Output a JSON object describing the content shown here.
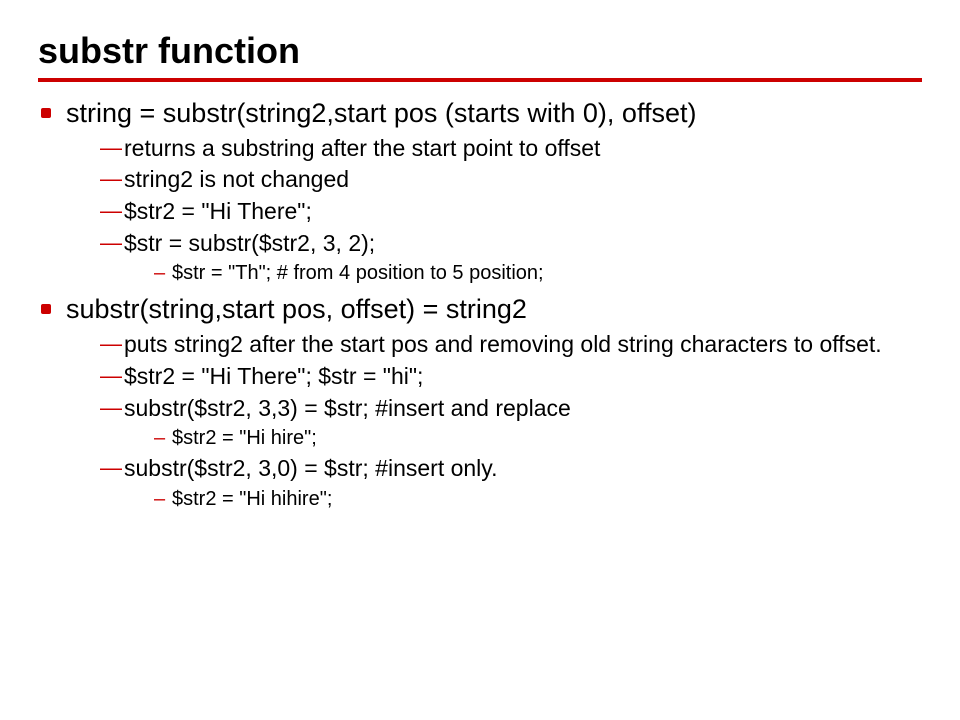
{
  "title": "substr function",
  "bullets": [
    {
      "text": "string = substr(string2,start pos (starts with 0), offset)",
      "sub": [
        {
          "text": "returns a substring after the start point to offset"
        },
        {
          "text": "string2 is not changed"
        },
        {
          "text": "$str2 = \"Hi There\";"
        },
        {
          "text": "$str = substr($str2, 3, 2);",
          "sub": [
            {
              "text": "$str = \"Th\"; # from 4 position to 5 position;"
            }
          ]
        }
      ]
    },
    {
      "text": "substr(string,start pos, offset) = string2",
      "sub": [
        {
          "text": "puts string2 after the start pos and removing old string characters to offset."
        },
        {
          "text": "$str2 = \"Hi There\"; $str = \"hi\";"
        },
        {
          "text": "substr($str2, 3,3) = $str; #insert and replace",
          "sub": [
            {
              "text": "$str2 = \"Hi hire\";"
            }
          ]
        },
        {
          "text": "substr($str2, 3,0) = $str; #insert only.",
          "sub": [
            {
              "text": "$str2 = \"Hi hihire\";"
            }
          ]
        }
      ]
    }
  ]
}
